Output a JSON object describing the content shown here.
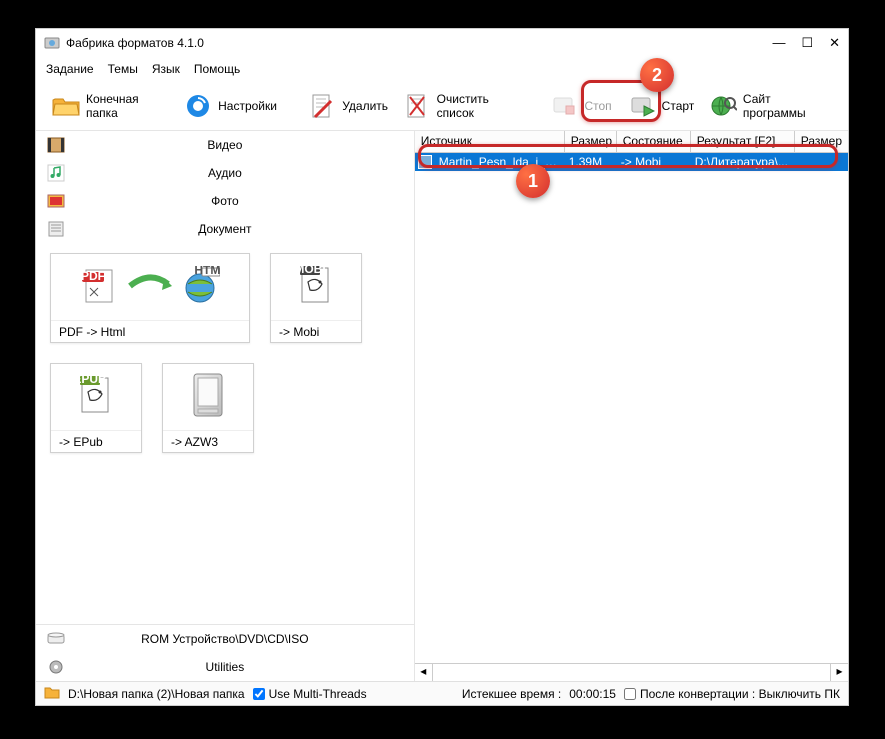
{
  "window": {
    "title": "Фабрика форматов 4.1.0"
  },
  "menu": {
    "task": "Задание",
    "themes": "Темы",
    "lang": "Язык",
    "help": "Помощь"
  },
  "toolbar": {
    "outfolder": "Конечная папка",
    "settings": "Настройки",
    "delete": "Удалить",
    "clear": "Очистить список",
    "stop": "Стоп",
    "start": "Старт",
    "site": "Сайт программы"
  },
  "categories": {
    "video": "Видео",
    "audio": "Аудио",
    "photo": "Фото",
    "document": "Документ"
  },
  "tiles": {
    "pdf_html": "PDF -> Html",
    "mobi": "-> Mobi",
    "epub": "-> EPub",
    "azw3": "-> AZW3"
  },
  "bottomcats": {
    "rom": "ROM Устройство\\DVD\\CD\\ISO",
    "utils": "Utilities"
  },
  "columns": {
    "source": "Источник",
    "size": "Размер",
    "state": "Состояние",
    "result": "Результат [F2]",
    "size2": "Размер"
  },
  "row": {
    "source": "Martin_Pesn_lda_i_pl...",
    "size": "1.39M",
    "state": "-> Mobi",
    "result": "D:\\Литература\\..."
  },
  "status": {
    "path": "D:\\Новая папка (2)\\Новая папка",
    "usemt": "Use Multi-Threads",
    "elapsed_label": "Истекшее время :",
    "elapsed_value": "00:00:15",
    "afterconv": "После конвертации : Выключить ПК"
  },
  "annotations": {
    "one": "1",
    "two": "2"
  }
}
